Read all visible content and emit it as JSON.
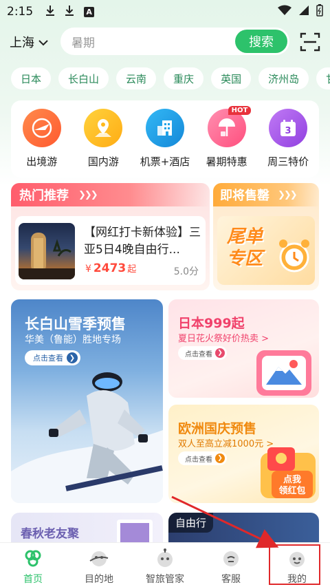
{
  "status_bar": {
    "time": "2:15",
    "a_icon": "A"
  },
  "header": {
    "city": "上海",
    "search_placeholder": "暑期",
    "search_button": "搜索"
  },
  "tags": [
    "日本",
    "长白山",
    "云南",
    "重庆",
    "英国",
    "济州岛",
    "甘"
  ],
  "categories": [
    {
      "label": "出境游",
      "icon": "plane-globe-icon",
      "color": "#ff6a3d"
    },
    {
      "label": "国内游",
      "icon": "map-pin-icon",
      "color": "#ffb81c"
    },
    {
      "label": "机票+酒店",
      "icon": "hotel-icon",
      "color": "#1fa3e8"
    },
    {
      "label": "暑期特惠",
      "icon": "beach-umbrella-icon",
      "color": "#ff5c8a",
      "badge": "HOT"
    },
    {
      "label": "周三特价",
      "icon": "calendar-icon",
      "color": "#a45ce8",
      "day": "3"
    }
  ],
  "hot_section": {
    "title": "热门推荐",
    "product_title": "【网红打卡新体验】三亚5日4晚自由行...",
    "price_currency": "¥",
    "price": "2473",
    "price_suffix": "起",
    "score": "5.0分"
  },
  "sellout_section": {
    "title": "即将售罄",
    "banner_line1": "尾单",
    "banner_line2": "专区"
  },
  "promos": {
    "left": {
      "title": "长白山雪季预售",
      "subtitle": "华美（鲁能）胜地专场",
      "button": "点击查看"
    },
    "right1": {
      "title": "日本999起",
      "subtitle": "夏日花火祭好价热卖 >",
      "button": "点击查看"
    },
    "right2": {
      "title": "欧洲国庆预售",
      "subtitle": "双人至高立减1000元 >",
      "button": "点击查看",
      "badge_line1": "点我",
      "badge_line2": "领红包"
    }
  },
  "row3": {
    "left_title": "春秋老友聚",
    "right_tag": "自由行"
  },
  "tab_bar": {
    "tabs": [
      {
        "label": "首页",
        "active": true
      },
      {
        "label": "目的地",
        "active": false
      },
      {
        "label": "智旅管家",
        "active": false
      },
      {
        "label": "客服",
        "active": false
      },
      {
        "label": "我的",
        "active": false
      }
    ]
  }
}
